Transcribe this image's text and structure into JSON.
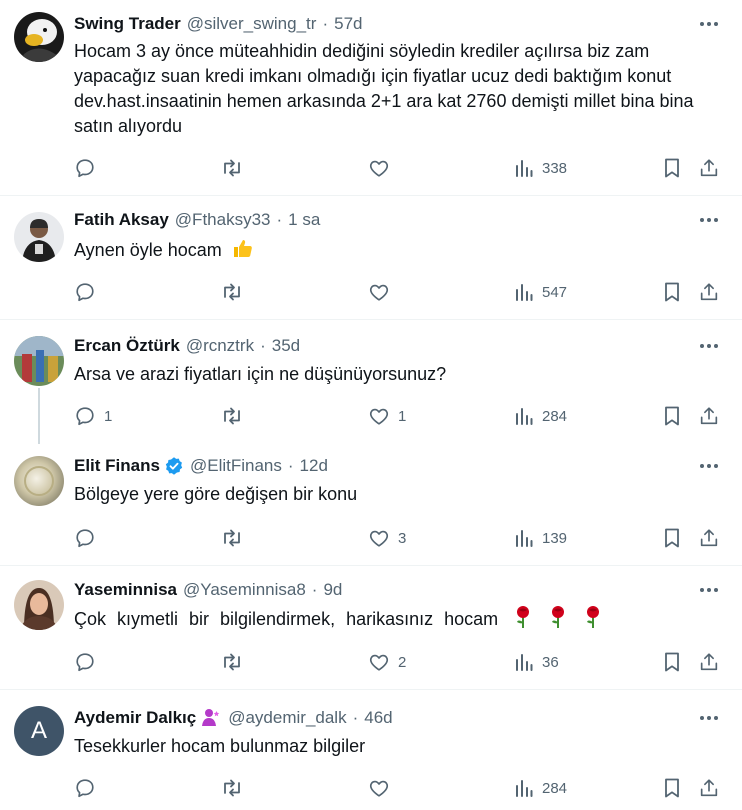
{
  "replies": [
    {
      "name": "Swing Trader",
      "handle": "@silver_swing_tr",
      "time": "57d",
      "text": "Hocam 3 ay önce müteahhidin dediğini söyledin krediler açılırsa biz zam yapacağız suan kredi imkanı olmadığı için fiyatlar ucuz dedi baktığım konut dev.hast.insaatinin hemen arkasında 2+1 ara kat 2760 demişti millet bina bina satın alıyordu",
      "replies": "",
      "reposts": "",
      "likes": "",
      "views": "338"
    },
    {
      "name": "Fatih Aksay",
      "handle": "@Fthaksy33",
      "time": "1 sa",
      "text": "Aynen öyle hocam",
      "emoji": "thumbs-up",
      "replies": "",
      "reposts": "",
      "likes": "",
      "views": "547"
    },
    {
      "name": "Ercan Öztürk",
      "handle": "@rcnztrk",
      "time": "35d",
      "text": "Arsa ve arazi fiyatları için ne düşünüyorsunuz?",
      "replies": "1",
      "reposts": "",
      "likes": "1",
      "views": "284"
    },
    {
      "name": "Elit Finans",
      "handle": "@ElitFinans",
      "time": "12d",
      "verified": true,
      "text": "Bölgeye yere göre değişen bir konu",
      "replies": "",
      "reposts": "",
      "likes": "3",
      "views": "139"
    },
    {
      "name": "Yaseminnisa",
      "handle": "@Yaseminnisa8",
      "time": "9d",
      "text": "Çok kıymetli bir bilgilendirmek, harikasınız hocam",
      "emoji": "rose x3",
      "replies": "",
      "reposts": "",
      "likes": "2",
      "views": "36"
    },
    {
      "name": "Aydemir Dalkıç",
      "handle": "@aydemir_dalk",
      "time": "46d",
      "emoji_after_name": "person-icon",
      "avatar_letter": "A",
      "text": "Tesekkurler hocam bulunmaz bilgiler",
      "replies": "",
      "reposts": "",
      "likes": "",
      "views": "284"
    }
  ],
  "colors": {
    "text": "#0f1419",
    "secondary": "#536471",
    "verified": "#1d9bf0",
    "thread_line": "#cfd9de",
    "separator": "#eff3f4"
  }
}
